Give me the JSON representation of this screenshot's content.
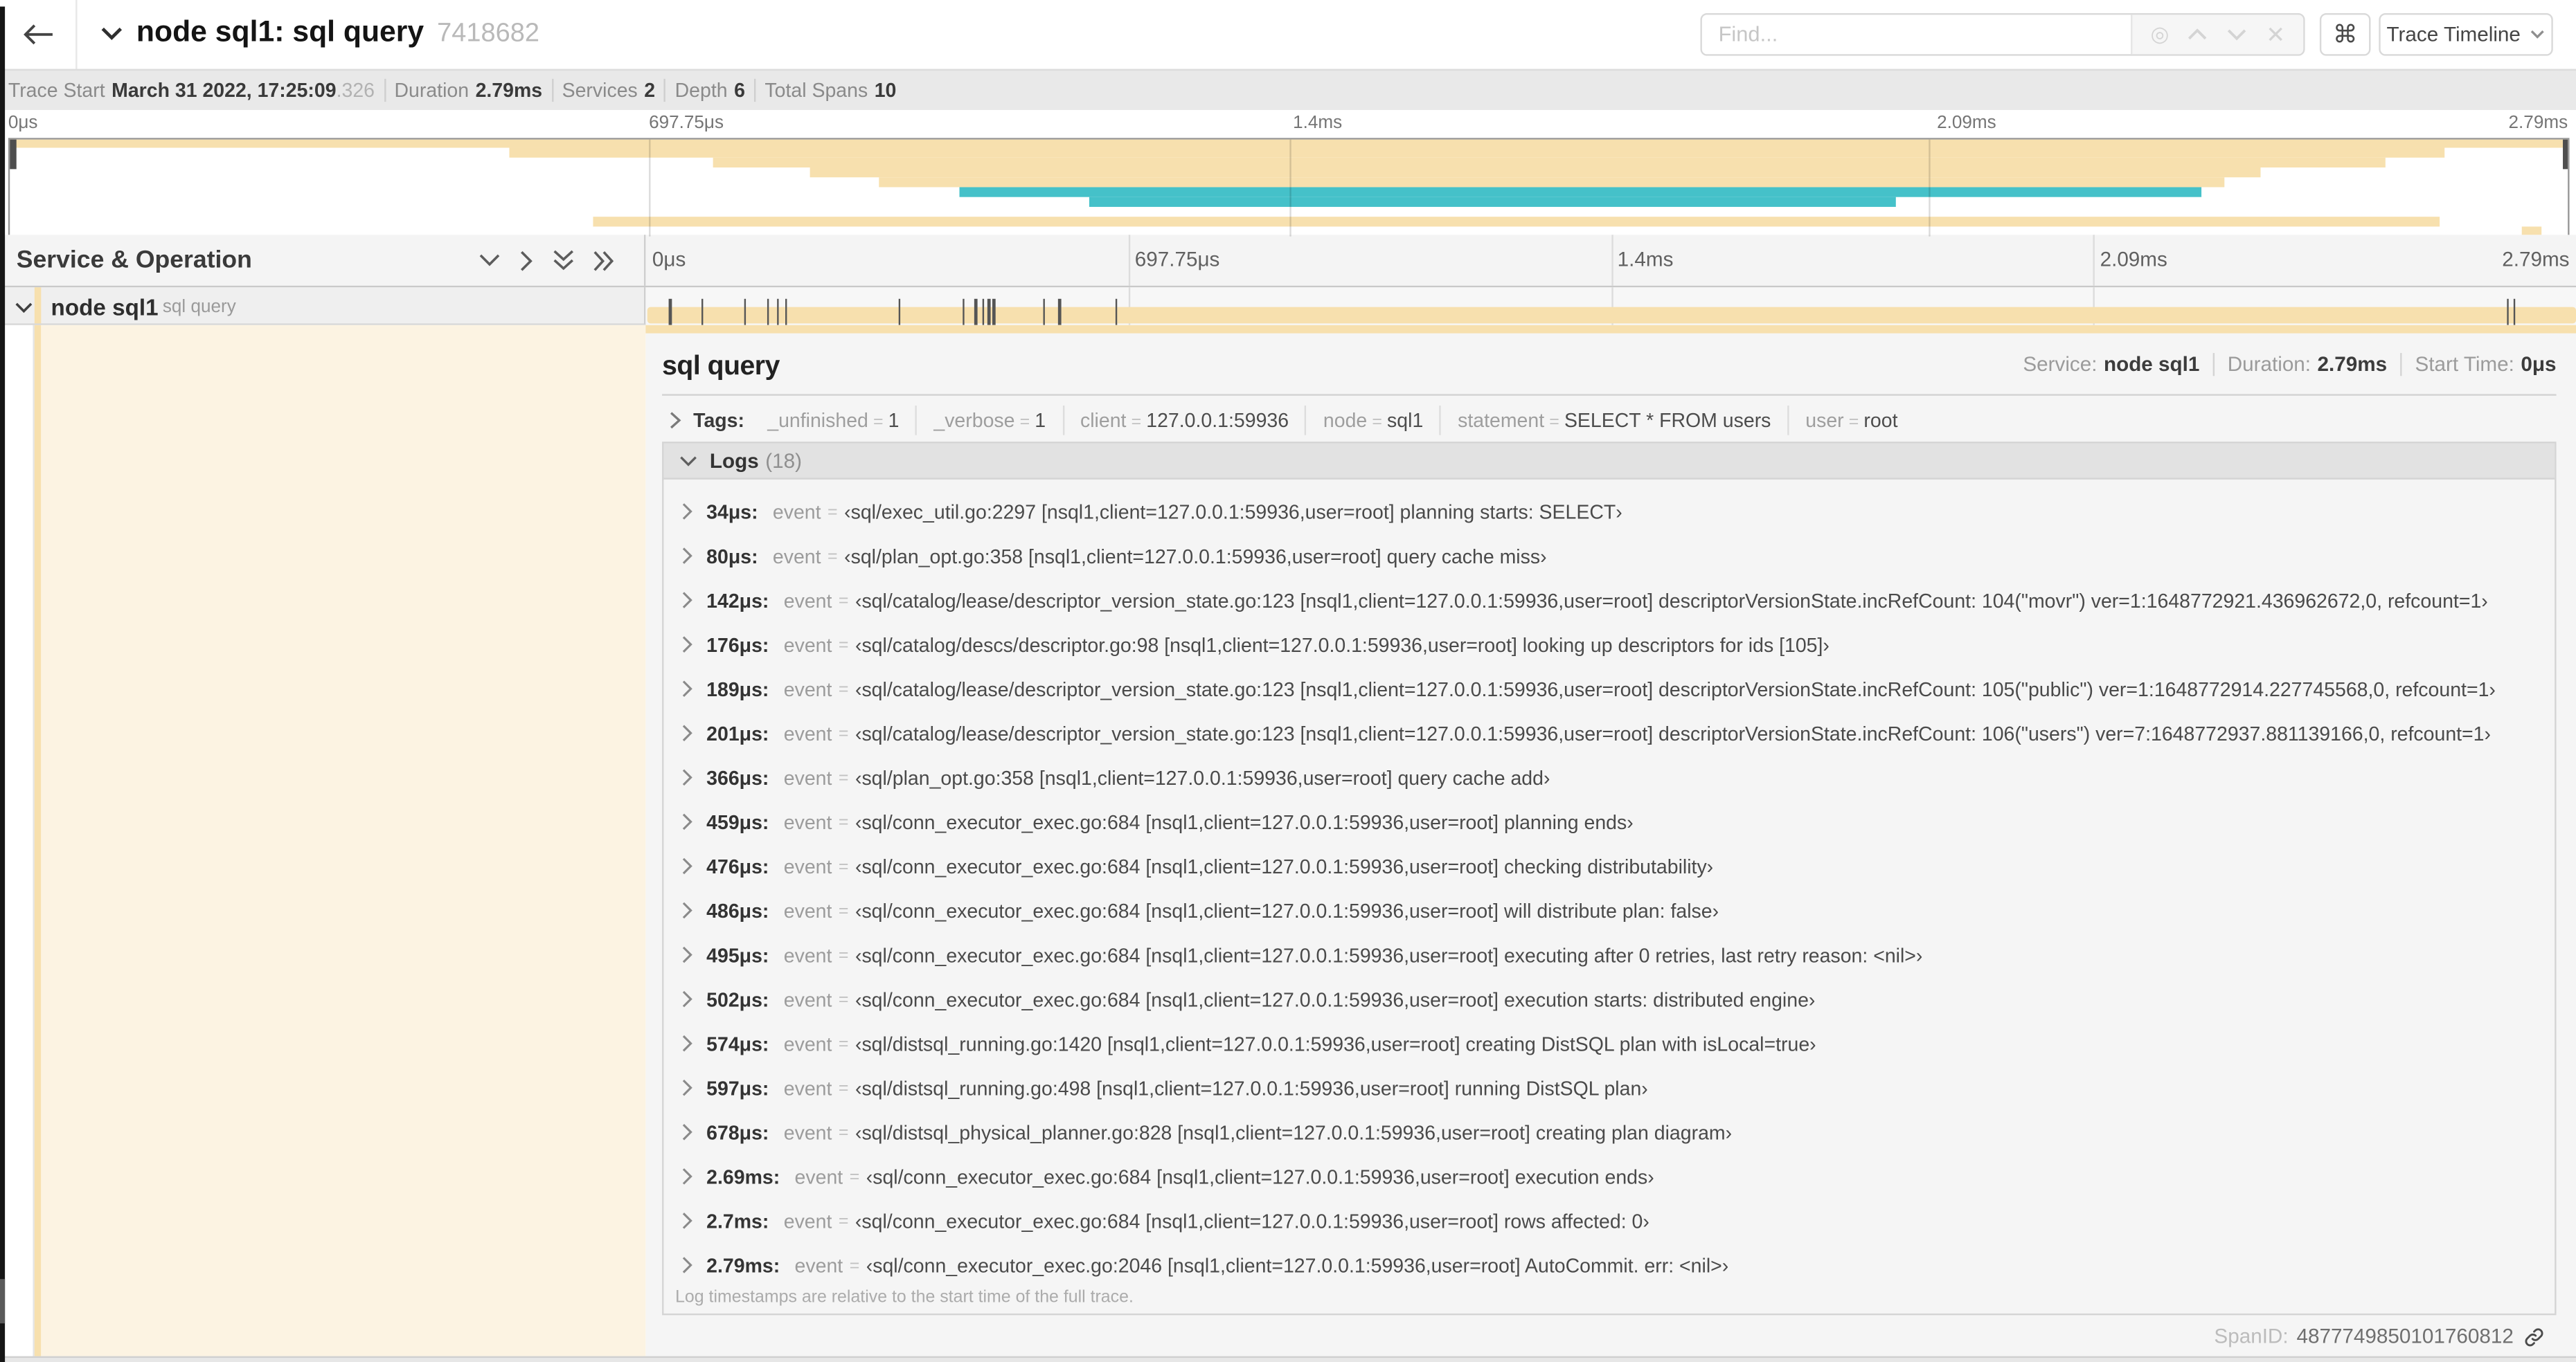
{
  "topbar": {
    "title": "node sql1: sql query",
    "trace_id": "7418682",
    "find_placeholder": "Find...",
    "cmd_glyph": "⌘",
    "view_select": "Trace Timeline"
  },
  "stats": {
    "trace_start_label": "Trace Start",
    "trace_start_value": "March 31 2022, 17:25:09",
    "trace_start_ms": ".326",
    "duration_label": "Duration",
    "duration_value": "2.79ms",
    "services_label": "Services",
    "services_value": "2",
    "depth_label": "Depth",
    "depth_value": "6",
    "total_spans_label": "Total Spans",
    "total_spans_value": "10"
  },
  "colors": {
    "tan": "#f7e0ae",
    "teal": "#45c1c9",
    "cream": "#fcf3e2"
  },
  "minimap": {
    "labels": [
      "0μs",
      "697.75μs",
      "1.4ms",
      "2.09ms",
      "2.79ms"
    ],
    "spans": [
      {
        "row": 0,
        "start": 0.0,
        "end": 1.0,
        "color": "tan"
      },
      {
        "row": 1,
        "start": 0.195,
        "end": 0.952,
        "color": "tan"
      },
      {
        "row": 2,
        "start": 0.275,
        "end": 0.929,
        "color": "tan"
      },
      {
        "row": 3,
        "start": 0.313,
        "end": 0.88,
        "color": "tan"
      },
      {
        "row": 4,
        "start": 0.34,
        "end": 0.866,
        "color": "tan"
      },
      {
        "row": 5,
        "start": 0.371,
        "end": 0.857,
        "color": "teal"
      },
      {
        "row": 6,
        "start": 0.422,
        "end": 0.737,
        "color": "teal"
      },
      {
        "row": 8,
        "start": 0.228,
        "end": 0.95,
        "color": "tan"
      },
      {
        "row": 9,
        "start": 0.982,
        "end": 0.99,
        "color": "tan"
      }
    ]
  },
  "timeline": {
    "header": "Service & Operation",
    "ruler_labels": [
      "0μs",
      "697.75μs",
      "1.4ms",
      "2.09ms",
      "2.79ms"
    ]
  },
  "span_row": {
    "service": "node sql1",
    "operation": "sql query",
    "total_us": 2790,
    "log_ticks_us": [
      34,
      80,
      142,
      176,
      189,
      201,
      366,
      459,
      476,
      486,
      495,
      502,
      574,
      597,
      678,
      2690,
      2700,
      2790
    ]
  },
  "detail": {
    "operation": "sql query",
    "service_label": "Service:",
    "service": "node sql1",
    "duration_label": "Duration:",
    "duration": "2.79ms",
    "start_label": "Start Time:",
    "start": "0μs",
    "tags_label": "Tags:",
    "tags": [
      {
        "key": "_unfinished",
        "value": "1"
      },
      {
        "key": "_verbose",
        "value": "1"
      },
      {
        "key": "client",
        "value": "127.0.0.1:59936"
      },
      {
        "key": "node",
        "value": "sql1"
      },
      {
        "key": "statement",
        "value": "SELECT * FROM users"
      },
      {
        "key": "user",
        "value": "root"
      }
    ],
    "logs_label": "Logs",
    "logs_count": "(18)",
    "log_key": "event",
    "logs": [
      {
        "t": "34μs:",
        "v": "‹sql/exec_util.go:2297 [nsql1,client=127.0.0.1:59936,user=root] planning starts: SELECT›"
      },
      {
        "t": "80μs:",
        "v": "‹sql/plan_opt.go:358 [nsql1,client=127.0.0.1:59936,user=root] query cache miss›"
      },
      {
        "t": "142μs:",
        "v": "‹sql/catalog/lease/descriptor_version_state.go:123 [nsql1,client=127.0.0.1:59936,user=root] descriptorVersionState.incRefCount: 104(\"movr\") ver=1:1648772921.436962672,0, refcount=1›"
      },
      {
        "t": "176μs:",
        "v": "‹sql/catalog/descs/descriptor.go:98 [nsql1,client=127.0.0.1:59936,user=root] looking up descriptors for ids [105]›"
      },
      {
        "t": "189μs:",
        "v": "‹sql/catalog/lease/descriptor_version_state.go:123 [nsql1,client=127.0.0.1:59936,user=root] descriptorVersionState.incRefCount: 105(\"public\") ver=1:1648772914.227745568,0, refcount=1›"
      },
      {
        "t": "201μs:",
        "v": "‹sql/catalog/lease/descriptor_version_state.go:123 [nsql1,client=127.0.0.1:59936,user=root] descriptorVersionState.incRefCount: 106(\"users\") ver=7:1648772937.881139166,0, refcount=1›"
      },
      {
        "t": "366μs:",
        "v": "‹sql/plan_opt.go:358 [nsql1,client=127.0.0.1:59936,user=root] query cache add›"
      },
      {
        "t": "459μs:",
        "v": "‹sql/conn_executor_exec.go:684 [nsql1,client=127.0.0.1:59936,user=root] planning ends›"
      },
      {
        "t": "476μs:",
        "v": "‹sql/conn_executor_exec.go:684 [nsql1,client=127.0.0.1:59936,user=root] checking distributability›"
      },
      {
        "t": "486μs:",
        "v": "‹sql/conn_executor_exec.go:684 [nsql1,client=127.0.0.1:59936,user=root] will distribute plan: false›"
      },
      {
        "t": "495μs:",
        "v": "‹sql/conn_executor_exec.go:684 [nsql1,client=127.0.0.1:59936,user=root] executing after 0 retries, last retry reason: <nil>›"
      },
      {
        "t": "502μs:",
        "v": "‹sql/conn_executor_exec.go:684 [nsql1,client=127.0.0.1:59936,user=root] execution starts: distributed engine›"
      },
      {
        "t": "574μs:",
        "v": "‹sql/distsql_running.go:1420 [nsql1,client=127.0.0.1:59936,user=root] creating DistSQL plan with isLocal=true›"
      },
      {
        "t": "597μs:",
        "v": "‹sql/distsql_running.go:498 [nsql1,client=127.0.0.1:59936,user=root] running DistSQL plan›"
      },
      {
        "t": "678μs:",
        "v": "‹sql/distsql_physical_planner.go:828 [nsql1,client=127.0.0.1:59936,user=root] creating plan diagram›"
      },
      {
        "t": "2.69ms:",
        "v": "‹sql/conn_executor_exec.go:684 [nsql1,client=127.0.0.1:59936,user=root] execution ends›"
      },
      {
        "t": "2.7ms:",
        "v": "‹sql/conn_executor_exec.go:684 [nsql1,client=127.0.0.1:59936,user=root] rows affected: 0›"
      },
      {
        "t": "2.79ms:",
        "v": "‹sql/conn_executor_exec.go:2046 [nsql1,client=127.0.0.1:59936,user=root] AutoCommit. err: <nil>›"
      }
    ],
    "logs_footer": "Log timestamps are relative to the start time of the full trace.",
    "spanid_label": "SpanID:",
    "spanid": "4877749850101760812"
  }
}
